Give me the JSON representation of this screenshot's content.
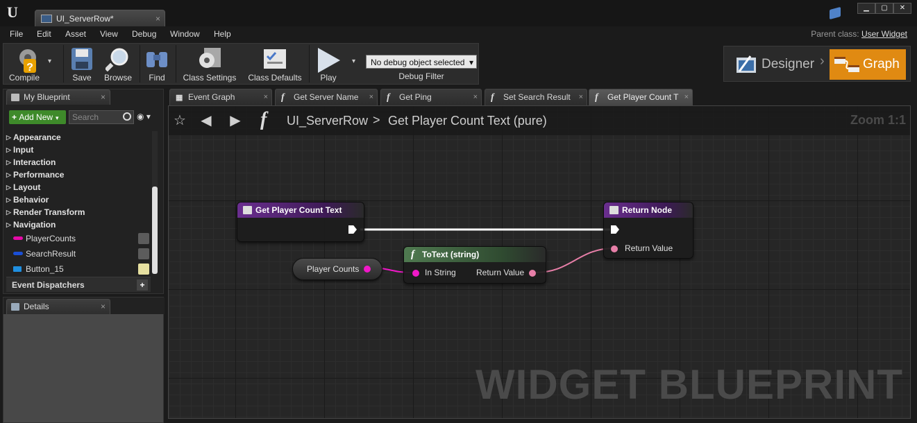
{
  "window": {
    "doc_tab": "UI_ServerRow*",
    "close": "×",
    "min": "▁",
    "max": "▢",
    "win_close": "✕"
  },
  "menu": [
    "File",
    "Edit",
    "Asset",
    "View",
    "Debug",
    "Window",
    "Help"
  ],
  "parent_class": {
    "label": "Parent class:",
    "value": "User Widget"
  },
  "toolbar": {
    "compile": "Compile",
    "save": "Save",
    "browse": "Browse",
    "find": "Find",
    "class_settings": "Class Settings",
    "class_defaults": "Class Defaults",
    "play": "Play",
    "debug_select": "No debug object selected",
    "debug_filter": "Debug Filter"
  },
  "mode": {
    "designer": "Designer",
    "graph": "Graph"
  },
  "my_blueprint": {
    "tab": "My Blueprint",
    "add_new": "Add New",
    "search_placeholder": "Search",
    "categories": [
      "Appearance",
      "Input",
      "Interaction",
      "Performance",
      "Layout",
      "Behavior",
      "Render Transform",
      "Navigation"
    ],
    "variables": [
      {
        "name": "PlayerCounts",
        "color": "#e60aa8"
      },
      {
        "name": "SearchResult",
        "color": "#1a4fd6"
      },
      {
        "name": "Button_15",
        "color": "#1f8fe0"
      }
    ],
    "event_dispatchers": "Event Dispatchers"
  },
  "details": {
    "tab": "Details"
  },
  "graph_tabs": [
    {
      "label": "Event Graph",
      "active": false
    },
    {
      "label": "Get Server Name",
      "active": false
    },
    {
      "label": "Get Ping",
      "active": false
    },
    {
      "label": "Set Search Result",
      "active": false
    },
    {
      "label": "Get Player Count T",
      "active": true
    }
  ],
  "breadcrumb": {
    "blueprint": "UI_ServerRow",
    "sep": ">",
    "function": "Get Player Count Text (pure)"
  },
  "zoom": "Zoom 1:1",
  "watermark": "WIDGET BLUEPRINT",
  "nodes": {
    "entry": {
      "title": "Get Player Count Text"
    },
    "return": {
      "title": "Return Node",
      "pin": "Return Value"
    },
    "totext": {
      "title": "ToText (string)",
      "in_pin": "In String",
      "out_pin": "Return Value"
    },
    "getvar": {
      "label": "Player Counts"
    }
  },
  "colors": {
    "string_pin": "#f018c8",
    "text_pin": "#e77fa8",
    "graph_accent": "#e08a12"
  }
}
